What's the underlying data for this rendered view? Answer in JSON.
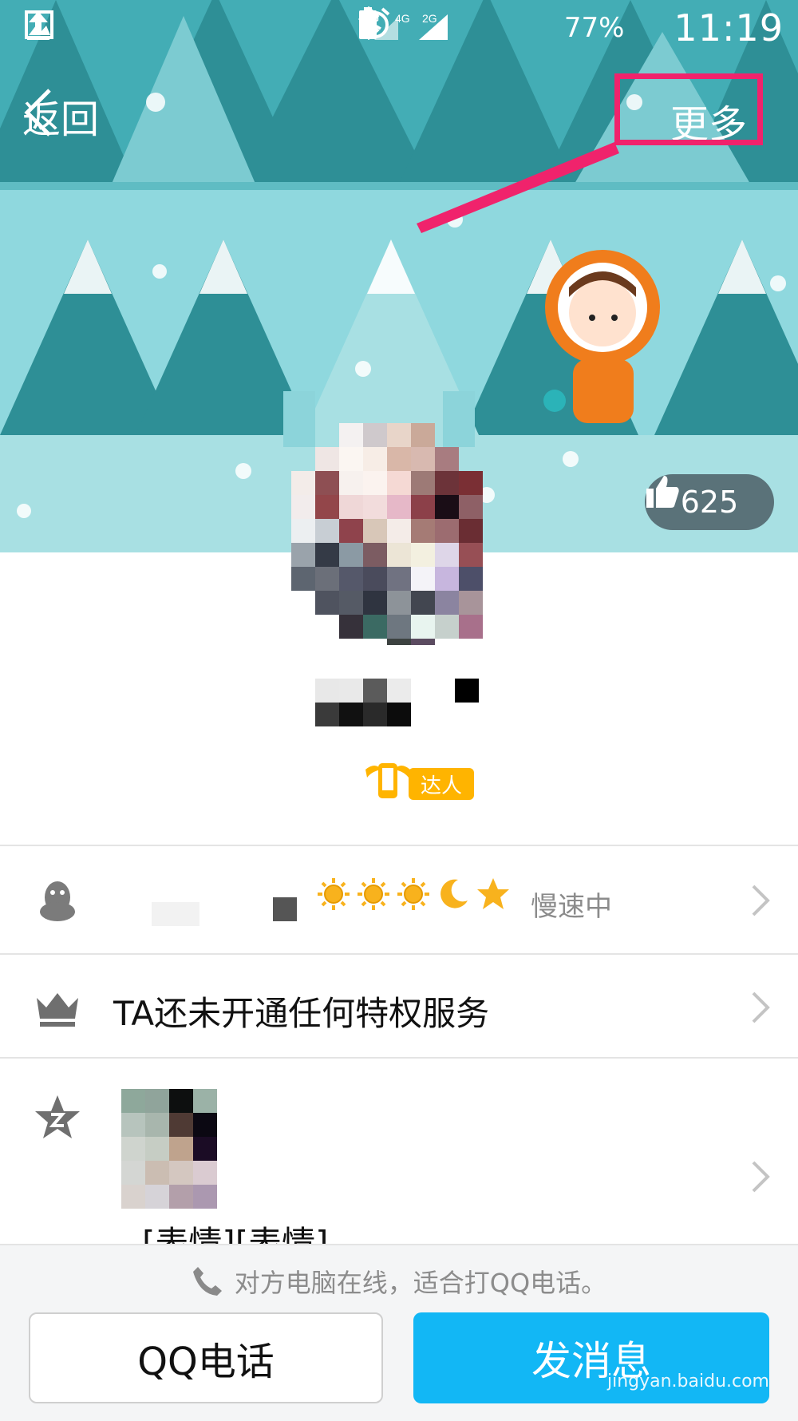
{
  "status_bar": {
    "network_labels": [
      "4G",
      "4G",
      "2G"
    ],
    "battery_percent": "77%",
    "time": "11:19",
    "icons": [
      "upload-icon",
      "image-icon",
      "bluetooth-icon",
      "alarm-icon",
      "signal-icon",
      "battery-icon"
    ]
  },
  "nav": {
    "back_label": "返回",
    "more_label": "更多"
  },
  "profile": {
    "likes": "625",
    "badge_label": "达人"
  },
  "rows": {
    "qq_status": "慢速中",
    "privilege_text": "TA还未开通任何特权服务",
    "qzone_text": "[表情][表情]"
  },
  "bottom": {
    "hint": "对方电脑在线，适合打QQ电话。",
    "call_button": "QQ电话",
    "message_button": "发消息"
  },
  "watermark": "jingyan.baidu.com",
  "colors": {
    "accent": "#12b7f5",
    "highlight": "#f0236c",
    "sky": "#8fd8de",
    "tree_dark": "#2e8f96",
    "tree_light": "#43adb5"
  }
}
